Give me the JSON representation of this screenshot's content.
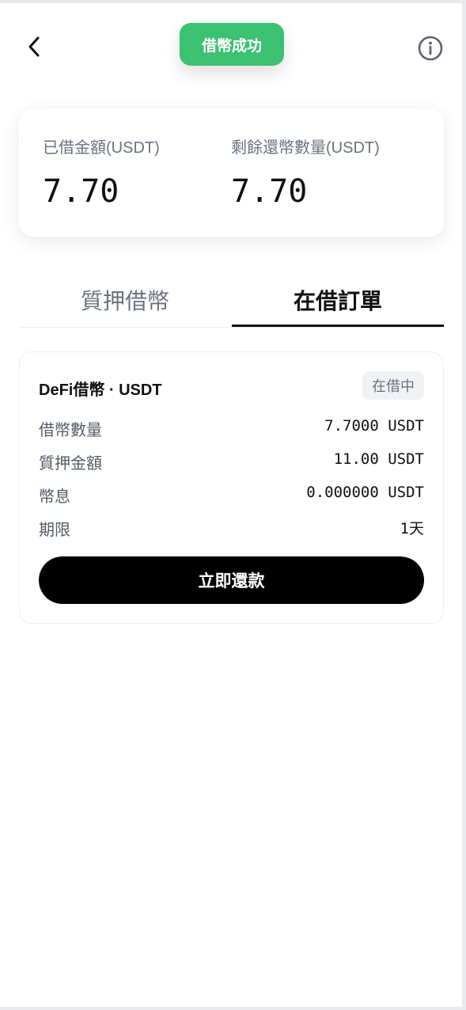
{
  "header": {
    "back_icon": "chevron-left-icon",
    "info_icon": "info-circle-icon"
  },
  "toast": {
    "message": "借幣成功",
    "color": "#3cc072"
  },
  "summary": {
    "borrowed_label": "已借金額(USDT)",
    "borrowed_value": "7.70",
    "remaining_label": "剩餘還幣數量(USDT)",
    "remaining_value": "7.70"
  },
  "tabs": [
    {
      "label": "質押借幣",
      "active": false
    },
    {
      "label": "在借訂單",
      "active": true
    }
  ],
  "order": {
    "title": "DeFi借幣 · USDT",
    "status": "在借中",
    "rows": [
      {
        "label": "借幣數量",
        "value": "7.7000 USDT"
      },
      {
        "label": "質押金額",
        "value": "11.00 USDT"
      },
      {
        "label": "幣息",
        "value": "0.000000 USDT"
      },
      {
        "label": "期限",
        "value": "1天"
      }
    ],
    "repay_label": "立即還款"
  }
}
